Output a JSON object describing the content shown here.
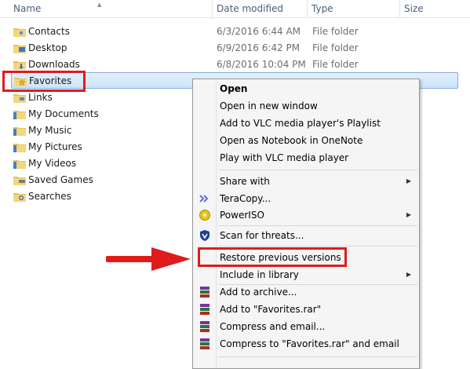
{
  "columns": {
    "name": "Name",
    "date": "Date modified",
    "type": "Type",
    "size": "Size"
  },
  "files": [
    {
      "name": "Contacts",
      "date": "6/3/2016 6:44 AM",
      "type": "File folder"
    },
    {
      "name": "Desktop",
      "date": "6/9/2016 6:42 PM",
      "type": "File folder"
    },
    {
      "name": "Downloads",
      "date": "6/8/2016 10:04 PM",
      "type": "File folder"
    },
    {
      "name": "Favorites",
      "date": "",
      "type": ""
    },
    {
      "name": "Links",
      "date": "",
      "type": ""
    },
    {
      "name": "My Documents",
      "date": "",
      "type": ""
    },
    {
      "name": "My Music",
      "date": "",
      "type": ""
    },
    {
      "name": "My Pictures",
      "date": "",
      "type": ""
    },
    {
      "name": "My Videos",
      "date": "",
      "type": ""
    },
    {
      "name": "Saved Games",
      "date": "",
      "type": ""
    },
    {
      "name": "Searches",
      "date": "",
      "type": ""
    }
  ],
  "menu": {
    "open": "Open",
    "open_new_window": "Open in new window",
    "add_vlc_playlist": "Add to VLC media player's Playlist",
    "open_onenote": "Open as Notebook in OneNote",
    "play_vlc": "Play with VLC media player",
    "share_with": "Share with",
    "teracopy": "TeraCopy...",
    "poweriso": "PowerISO",
    "scan_threats": "Scan for threats...",
    "restore_versions": "Restore previous versions",
    "include_library": "Include in library",
    "add_archive": "Add to archive...",
    "add_rar": "Add to \"Favorites.rar\"",
    "compress_email": "Compress and email...",
    "compress_rar_email": "Compress to \"Favorites.rar\" and email"
  },
  "colors": {
    "highlight": "#e01b1b",
    "selection": "#cce4fa"
  }
}
